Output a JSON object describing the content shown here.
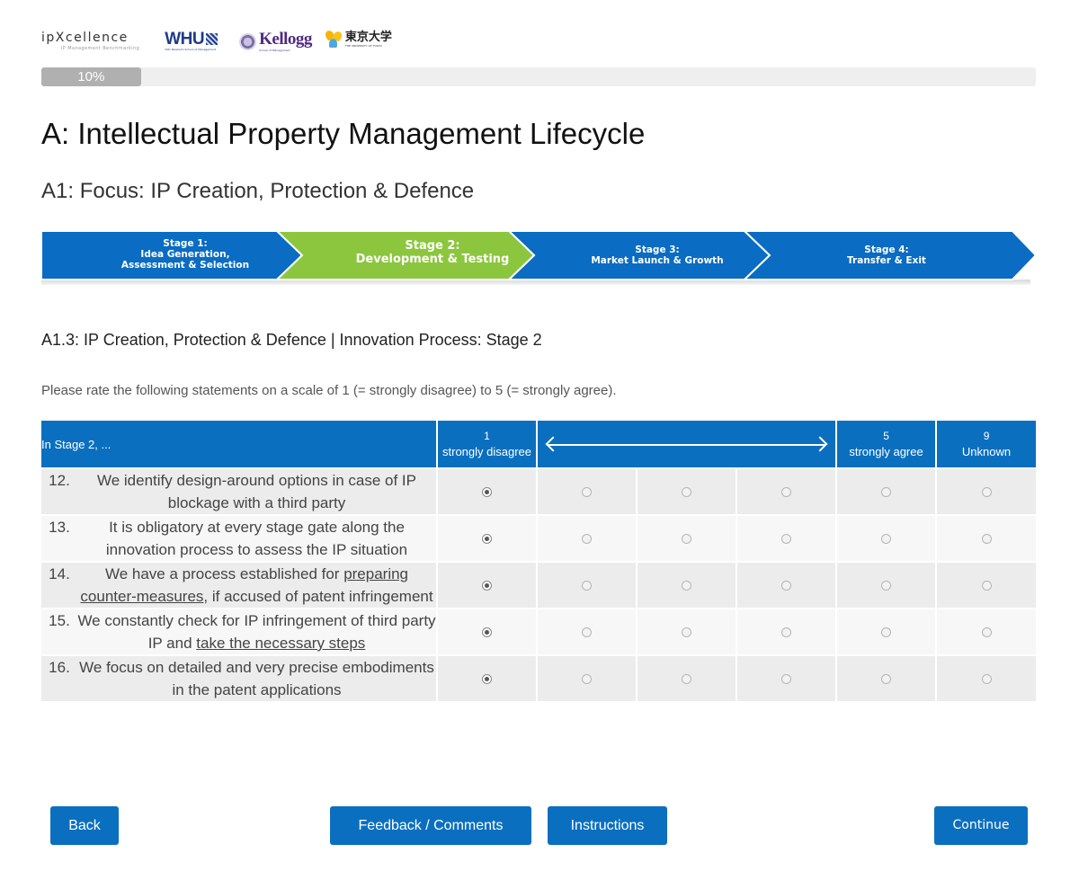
{
  "header": {
    "logos": [
      {
        "name": "ipXcellence",
        "tagline": "IP Management Benchmarking"
      },
      {
        "name": "WHU",
        "tagline": "Otto Beisheim School of Management"
      },
      {
        "name": "Kellogg",
        "tagline": "School of Management"
      },
      {
        "name": "東京大学",
        "tagline": "THE UNIVERSITY OF TOKYO"
      }
    ]
  },
  "progress": {
    "percent": 10,
    "label": "10%"
  },
  "page": {
    "title": "A: Intellectual Property Management Lifecycle",
    "subtitle": "A1: Focus: IP Creation, Protection & Defence",
    "section_title": "A1.3: IP Creation, Protection & Defence | Innovation Process: Stage 2",
    "instructions": "Please rate the following statements on a scale of 1 (= strongly disagree) to 5 (= strongly agree)."
  },
  "stages": [
    {
      "title": "Stage 1:",
      "line2": "Idea Generation,",
      "line3": "Assessment & Selection",
      "active": false
    },
    {
      "title": "Stage 2:",
      "line2": "Development & Testing",
      "active": true
    },
    {
      "title": "Stage 3:",
      "line2": "Market Launch & Growth",
      "active": false
    },
    {
      "title": "Stage 4:",
      "line2": "Transfer & Exit",
      "active": false
    }
  ],
  "colors": {
    "primary": "#0b6fbf",
    "active_stage": "#8cc63f",
    "stage_blue": "#0a6cc2"
  },
  "table": {
    "stem_header": "In Stage 2, ...",
    "scale": [
      {
        "num": "1",
        "label": "strongly disagree"
      },
      {
        "num": "5",
        "label": "strongly agree"
      },
      {
        "num": "9",
        "label": "Unknown"
      }
    ],
    "questions": [
      {
        "num": "12.",
        "text": "We identify design-around options in case of IP blockage with a third party",
        "selected": 0
      },
      {
        "num": "13.",
        "text": "It is obligatory at every stage gate along the innovation process to assess the IP situation",
        "selected": 0
      },
      {
        "num": "14.",
        "pre": "We have a process established for ",
        "link": "preparing counter-measures",
        "post": ", if accused of patent infringement",
        "selected": 0
      },
      {
        "num": "15.",
        "pre": "We constantly check for IP infringement of third party IP and ",
        "link": "take the necessary steps",
        "post": "",
        "selected": 0
      },
      {
        "num": "16.",
        "text": "We focus on detailed and very precise embodiments in the patent applications",
        "selected": 0
      }
    ]
  },
  "buttons": {
    "back": "Back",
    "feedback": "Feedback / Comments",
    "instructions": "Instructions",
    "continue": "Continue"
  }
}
